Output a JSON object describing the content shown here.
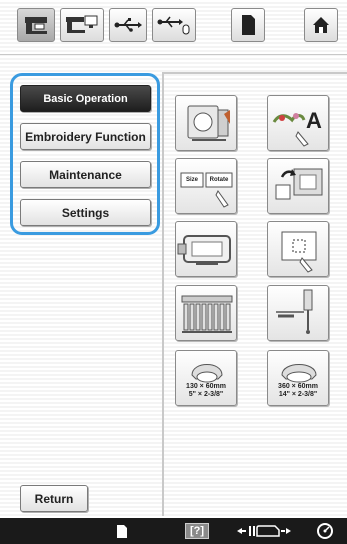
{
  "menu": {
    "items": [
      {
        "label": "Basic Operation",
        "active": true
      },
      {
        "label": "Embroidery Function",
        "active": false
      },
      {
        "label": "Maintenance",
        "active": false
      },
      {
        "label": "Settings",
        "active": false
      }
    ],
    "highlight_color": "#3a9be0"
  },
  "top_icons": [
    "machine-icon",
    "machine-pc-icon",
    "usb-icon",
    "usb-mouse-icon",
    "memory-card-icon",
    "home-icon"
  ],
  "tiles": {
    "size_label": "Size",
    "rotate_label": "Rotate",
    "text_letter": "A",
    "frame_small": {
      "line1": "130 × 60mm",
      "line2": "5\" × 2-3/8\""
    },
    "frame_large": {
      "line1": "360 × 60mm",
      "line2": "14\" × 2-3/8\""
    }
  },
  "return_label": "Return",
  "bottom_bar": {
    "help_label": "[?]",
    "icons": [
      "document-icon",
      "help-icon",
      "presser-foot-icon",
      "sewing-speed-icon"
    ]
  }
}
